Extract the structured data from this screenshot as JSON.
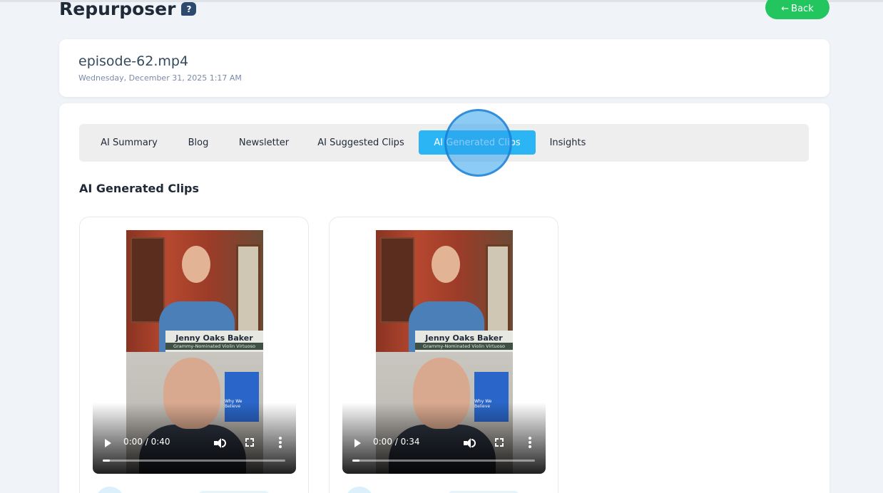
{
  "header": {
    "title": "Repurposer",
    "help_icon": "question-chat-icon",
    "back_label": "Back",
    "back_icon": "←"
  },
  "file": {
    "name": "episode-62.mp4",
    "date": "Wednesday, December 31, 2025 1:17 AM"
  },
  "tabs": [
    {
      "label": "AI Summary",
      "active": false
    },
    {
      "label": "Blog",
      "active": false
    },
    {
      "label": "Newsletter",
      "active": false
    },
    {
      "label": "AI Suggested Clips",
      "active": false
    },
    {
      "label": "AI Generated Clips",
      "active": true
    },
    {
      "label": "Insights",
      "active": false
    }
  ],
  "section_title": "AI Generated Clips",
  "clips": [
    {
      "time": "0:00 / 0:40",
      "progress": 0,
      "guest_name": "Jenny Oaks Baker",
      "guest_role": "Grammy-Nominated Violin Virtuoso",
      "screen_text": "Why We Believe"
    },
    {
      "time": "0:00 / 0:34",
      "progress": 0,
      "guest_name": "Jenny Oaks Baker",
      "guest_role": "Grammy-Nominated Violin Virtuoso",
      "screen_text": "Why We Believe"
    }
  ],
  "colors": {
    "accent": "#2bb5f5",
    "back_button": "#22c55e",
    "background": "#f0f4f8"
  }
}
